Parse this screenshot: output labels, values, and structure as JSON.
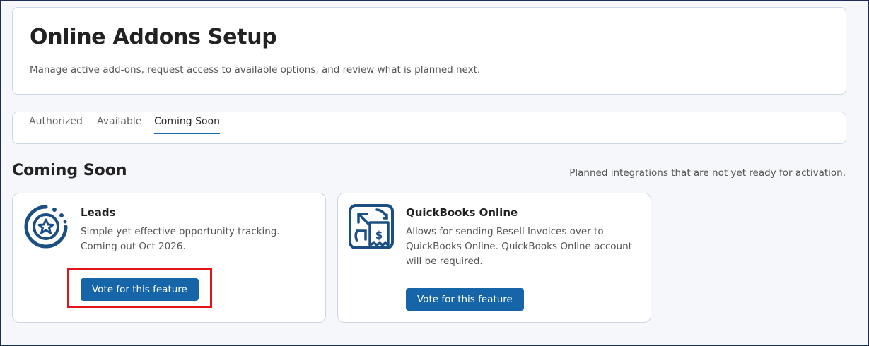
{
  "header": {
    "title": "Online Addons Setup",
    "subtitle": "Manage active add-ons, request access to available options, and review what is planned next."
  },
  "tabs": [
    {
      "label": "Authorized",
      "active": false
    },
    {
      "label": "Available",
      "active": false
    },
    {
      "label": "Coming Soon",
      "active": true
    }
  ],
  "section": {
    "title": "Coming Soon",
    "note": "Planned integrations that are not yet ready for activation."
  },
  "addons": [
    {
      "name": "Leads",
      "description": "Simple yet effective opportunity tracking. Coming out Oct 2026.",
      "icon": "star-circle-icon",
      "button_label": "Vote for this feature"
    },
    {
      "name": "QuickBooks Online",
      "description": "Allows for sending Resell Invoices over to QuickBooks Online. QuickBooks Online account will be required.",
      "icon": "invoice-sync-icon",
      "button_label": "Vote for this feature"
    }
  ],
  "colors": {
    "accent": "#1565a8",
    "icon": "#1b4f82",
    "highlight": "#e01414"
  }
}
